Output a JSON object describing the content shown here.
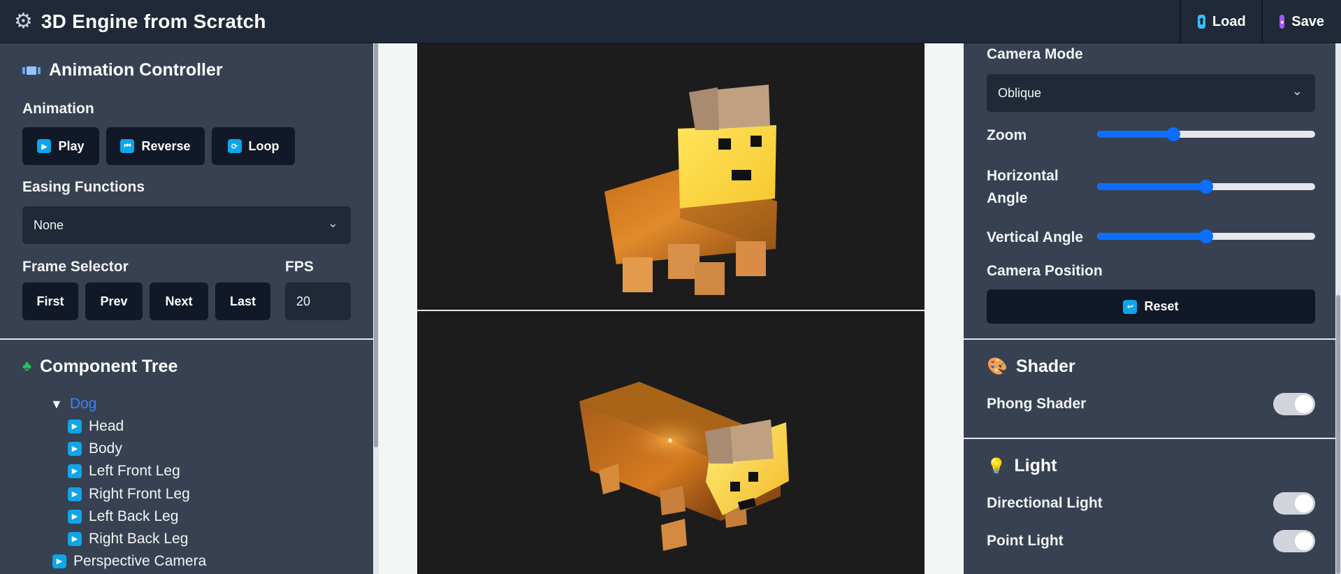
{
  "header": {
    "title": "3D Engine from Scratch",
    "load_label": "Load",
    "save_label": "Save"
  },
  "animation": {
    "section_title": "Animation Controller",
    "animation_label": "Animation",
    "play_label": "Play",
    "reverse_label": "Reverse",
    "loop_label": "Loop",
    "easing_label": "Easing Functions",
    "easing_value": "None",
    "frame_selector_label": "Frame Selector",
    "fps_label": "FPS",
    "fps_value": "20",
    "first_label": "First",
    "prev_label": "Prev",
    "next_label": "Next",
    "last_label": "Last"
  },
  "tree": {
    "section_title": "Component Tree",
    "root": "Dog",
    "children": [
      "Head",
      "Body",
      "Left Front Leg",
      "Right Front Leg",
      "Left Back Leg",
      "Right Back Leg"
    ],
    "camera": "Perspective Camera"
  },
  "camera": {
    "mode_label": "Camera Mode",
    "mode_value": "Oblique",
    "zoom_label": "Zoom",
    "zoom_value": 0.35,
    "horizontal_label_1": "Horizontal",
    "horizontal_label_2": "Angle",
    "horizontal_value": 0.5,
    "vertical_label": "Vertical Angle",
    "vertical_value": 0.5,
    "position_label": "Camera Position",
    "reset_label": "Reset"
  },
  "shader": {
    "section_title": "Shader",
    "phong_label": "Phong Shader",
    "phong_on": true
  },
  "light": {
    "section_title": "Light",
    "directional_label": "Directional Light",
    "directional_on": true,
    "point_label": "Point Light",
    "point_on": true
  },
  "colors": {
    "accent": "#0d6efd",
    "panel": "#374151",
    "button": "#111827",
    "canvas": "#1c1c1c"
  }
}
